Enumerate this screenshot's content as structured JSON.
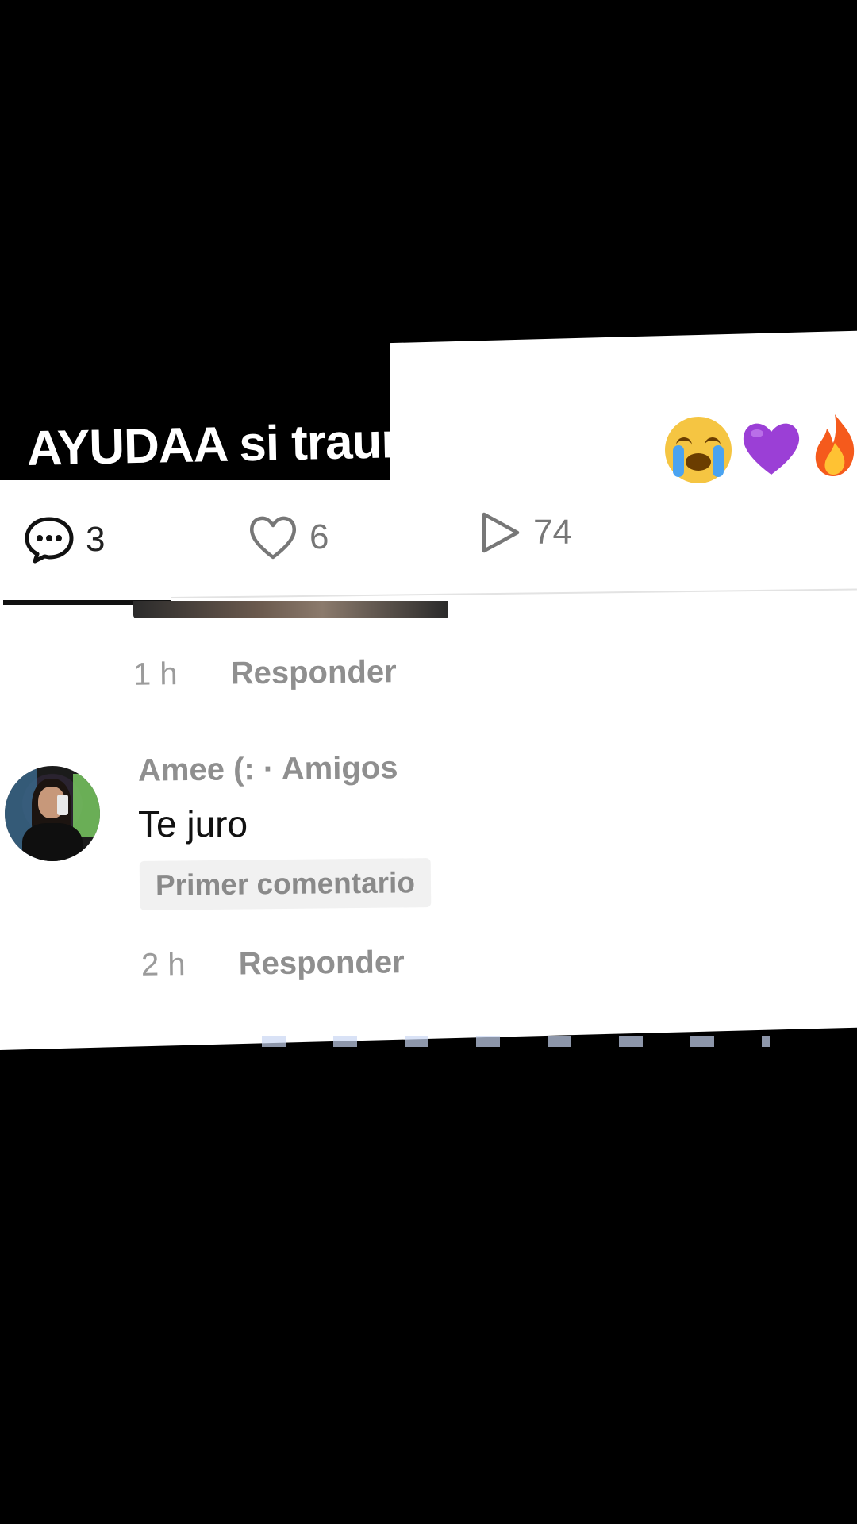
{
  "video_caption": {
    "text": "AYUDAA si traume a Ame",
    "emojis": [
      "loudly-crying-face-emoji",
      "purple-heart-emoji",
      "fire-emoji"
    ]
  },
  "stats": {
    "comments": "3",
    "likes": "6",
    "views": "74"
  },
  "comments": [
    {
      "time": "1 h",
      "reply_label": "Responder"
    },
    {
      "author": "Amee (: · Amigos",
      "text": "Te juro",
      "badge": "Primer comentario",
      "time": "2 h",
      "reply_label": "Responder"
    }
  ]
}
